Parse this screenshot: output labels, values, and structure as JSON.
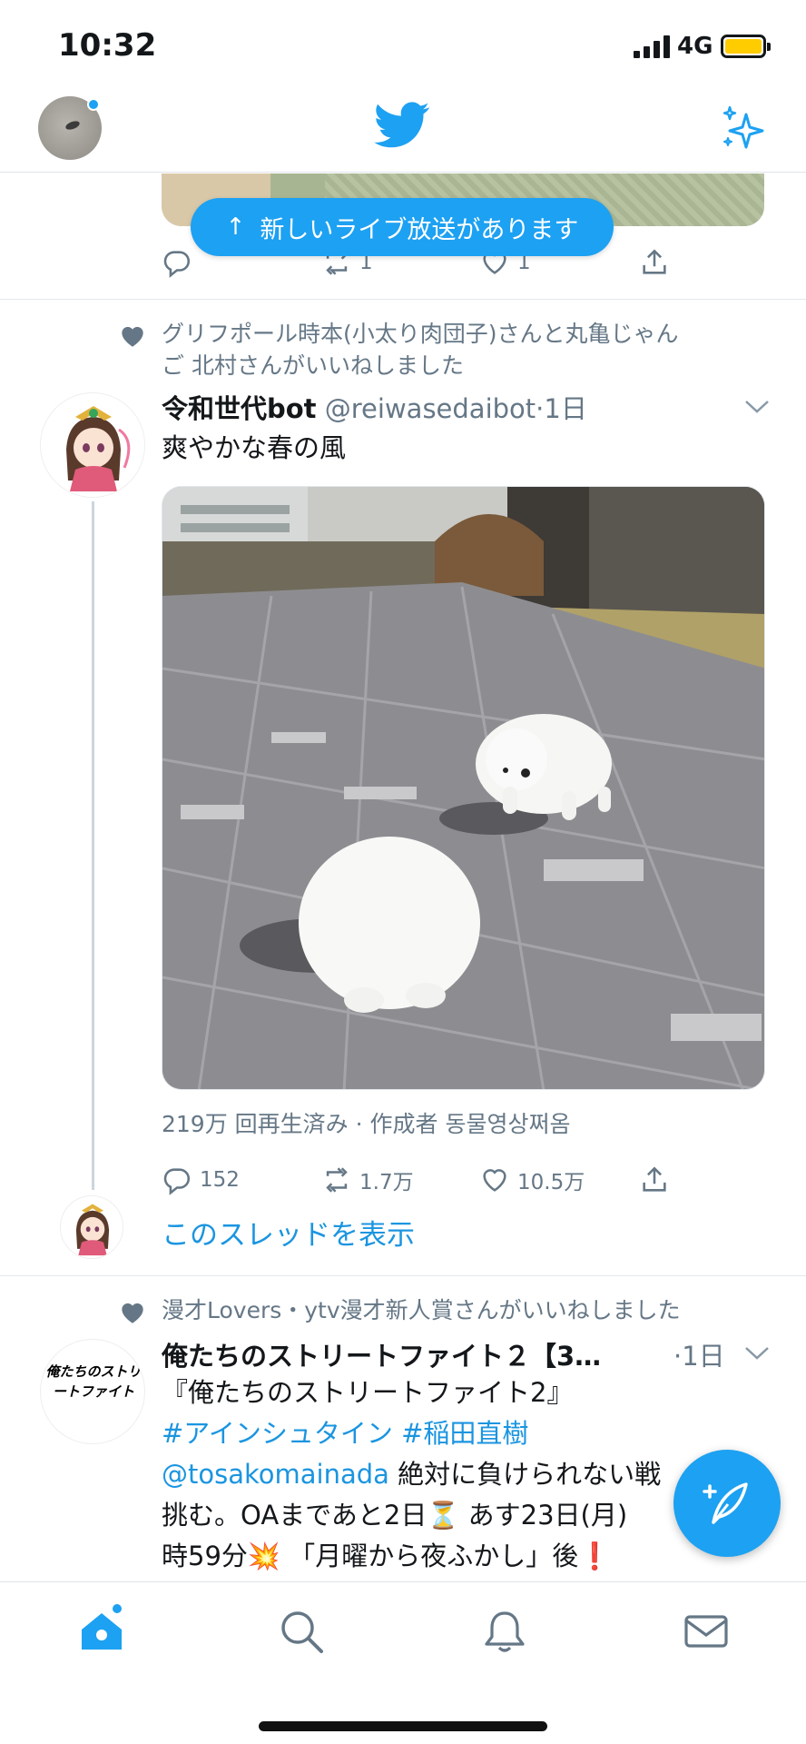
{
  "status_bar": {
    "time": "10:32",
    "network": "4G"
  },
  "live_banner": {
    "label": "新しいライブ放送があります"
  },
  "first_tweet": {
    "reply_count": "",
    "retweet_count": "1",
    "like_count": "1"
  },
  "tweet2": {
    "social_context_line1": "グリフポール時本(小太り肉団子)さんと丸亀じゃん",
    "social_context_line2": "ご 北村さんがいいねしました",
    "display_name": "令和世代bot",
    "handle": "@reiwasedaibot",
    "time": "·1日",
    "text": "爽やかな春の風",
    "views": "219万 回再生済み · 作成者 동물영상쩌옴",
    "replies": "152",
    "retweets": "1.7万",
    "likes": "10.5万",
    "show_thread": "このスレッドを表示"
  },
  "tweet3": {
    "social_context": "漫才Lovers・ytv漫才新人賞さんがいいねしました",
    "display_name": "俺たちのストリートファイト２【3…",
    "time": "·1日",
    "line1": "『俺たちのストリートファイト2』",
    "hashtag1": "#アインシュタイン",
    "hashtag2": "#稲田直樹",
    "mention": "@tosakomainada",
    "line3_rest": " 絶対に負けられない戦",
    "line4": "挑む。OAまであと2日⏳ あす23日(月)",
    "line5": "時59分💥 「月曜から夜ふかし」後❗",
    "logo_text": "俺たちのストリートファイト"
  },
  "colors": {
    "brand": "#1da1f2",
    "link": "#1b95e0",
    "muted": "#657786"
  },
  "icons": {
    "header": [
      "avatar",
      "twitter-bird-icon",
      "sparkle-icon"
    ],
    "tab_bar": [
      "home-icon",
      "search-icon",
      "notifications-bell-icon",
      "messages-envelope-icon"
    ],
    "fab": "compose-tweet-icon"
  }
}
